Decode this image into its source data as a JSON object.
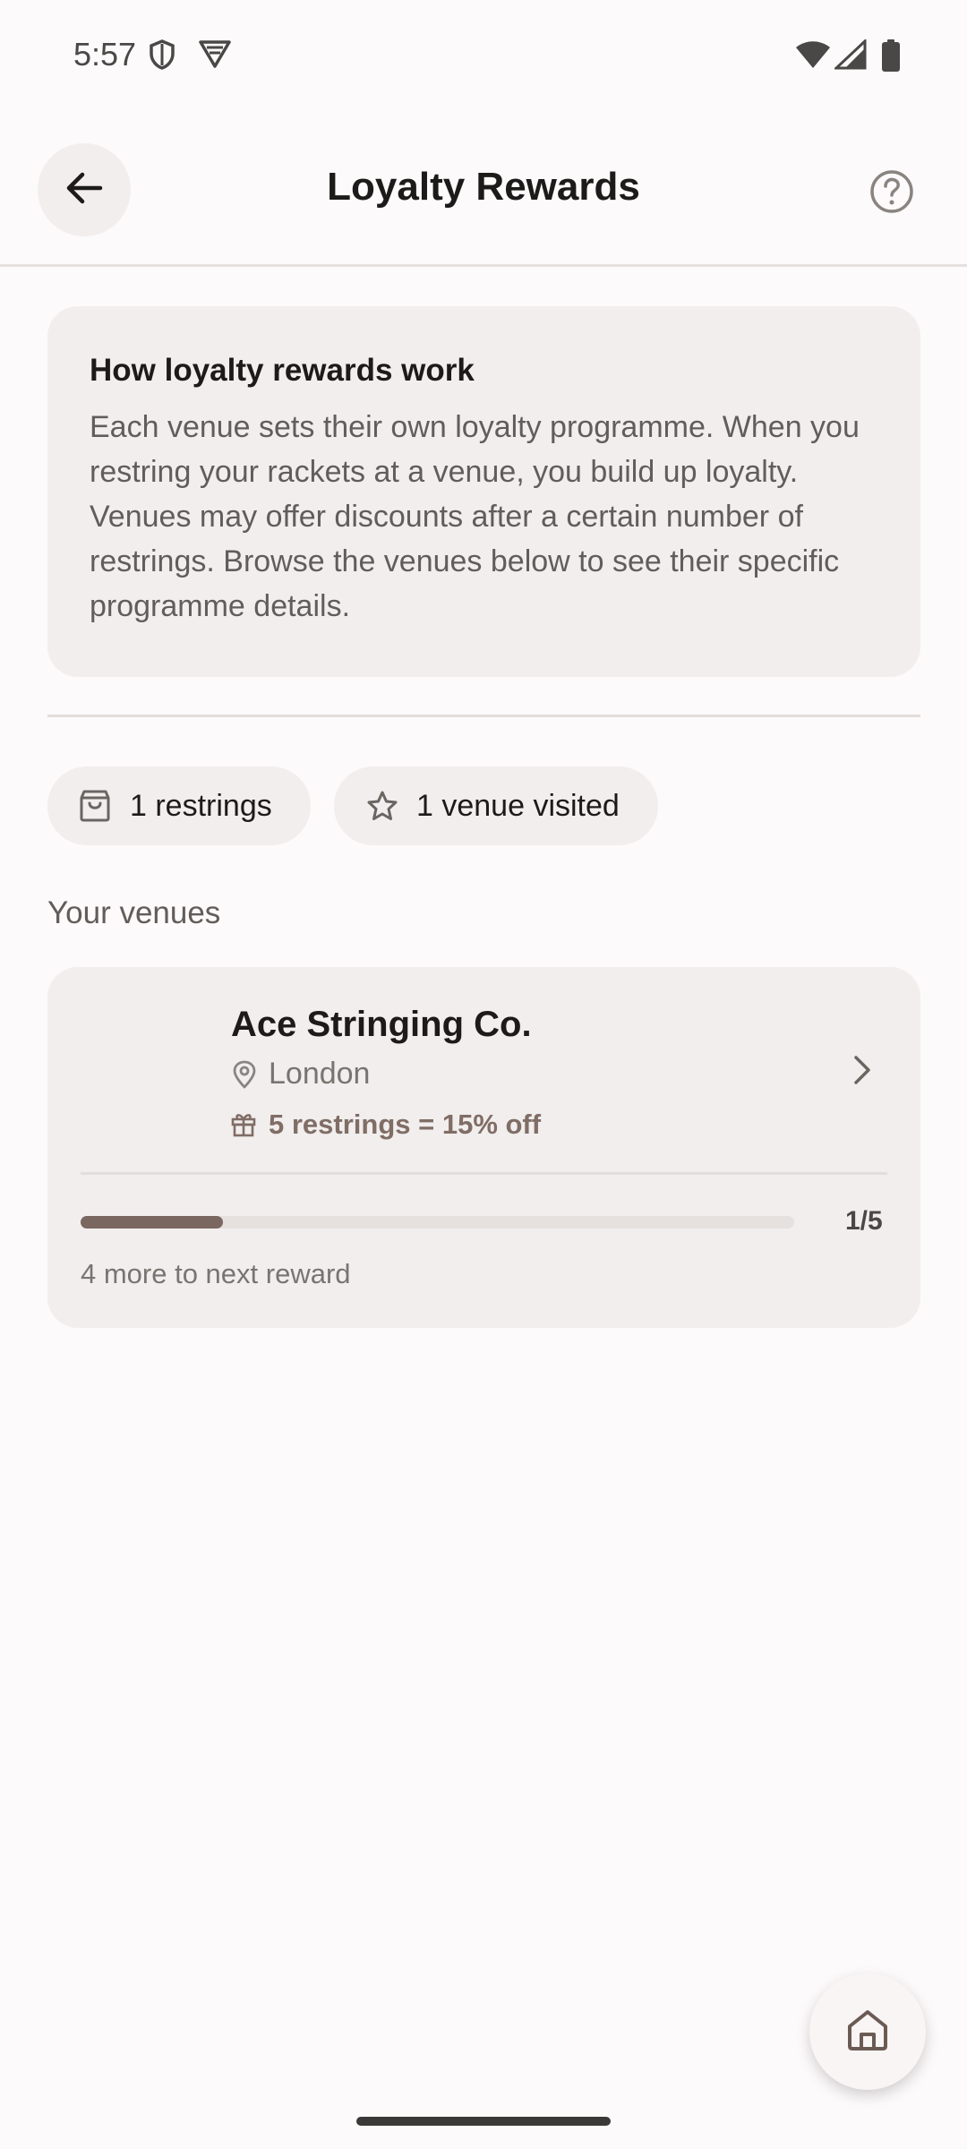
{
  "status_bar": {
    "time": "5:57",
    "icons": [
      "shield-icon",
      "vpn-icon",
      "wifi-icon",
      "cellular-icon",
      "battery-icon"
    ]
  },
  "app_bar": {
    "title": "Loyalty Rewards",
    "back_icon": "arrow-left-icon",
    "help_icon": "help-circle-icon"
  },
  "info_card": {
    "title": "How loyalty rewards work",
    "body": "Each venue sets their own loyalty programme. When you restring your rackets at a venue, you build up loyalty. Venues may offer discounts after a certain number of restrings. Browse the venues below to see their specific programme details."
  },
  "stats": [
    {
      "icon": "bag-icon",
      "label": "1 restrings"
    },
    {
      "icon": "star-icon",
      "label": "1 venue visited"
    }
  ],
  "venues_section": {
    "label": "Your venues",
    "venues": [
      {
        "name": "Ace Stringing Co.",
        "location": "London",
        "offer": "5 restrings = 15% off",
        "progress_label": "1/5",
        "progress_fraction": 0.2,
        "note": "4 more to next reward"
      }
    ]
  },
  "fab": {
    "icon": "home-icon"
  },
  "colors": {
    "background": "#fcfafa",
    "card": "#f1eeed",
    "accent": "#7a6760",
    "offer_text": "#806d66"
  }
}
